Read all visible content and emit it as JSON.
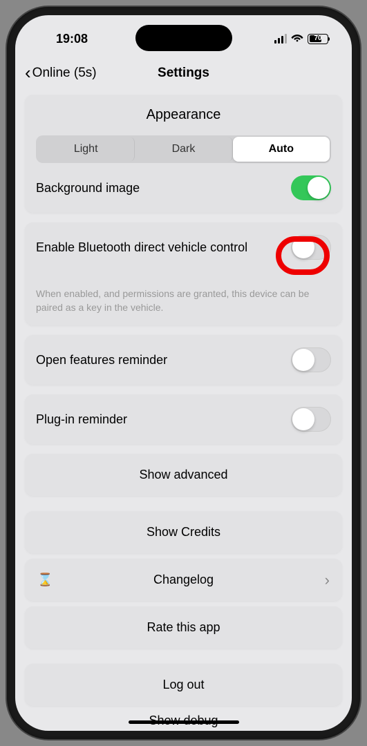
{
  "status": {
    "time": "19:08",
    "battery": "70"
  },
  "nav": {
    "back_label": "Online (5s)",
    "title": "Settings"
  },
  "appearance": {
    "title": "Appearance",
    "options": {
      "light": "Light",
      "dark": "Dark",
      "auto": "Auto"
    },
    "bg_image_label": "Background image",
    "bg_image_enabled": true
  },
  "bluetooth": {
    "label": "Enable Bluetooth direct vehicle control",
    "enabled": false,
    "description": "When enabled, and permissions are granted, this device can be paired as a key in the vehicle."
  },
  "reminders": {
    "open_features_label": "Open features reminder",
    "open_features_enabled": false,
    "plugin_label": "Plug-in reminder",
    "plugin_enabled": false
  },
  "buttons": {
    "show_advanced": "Show advanced",
    "show_credits": "Show Credits",
    "changelog": "Changelog",
    "rate": "Rate this app",
    "logout": "Log out",
    "show_debug": "Show debug"
  }
}
